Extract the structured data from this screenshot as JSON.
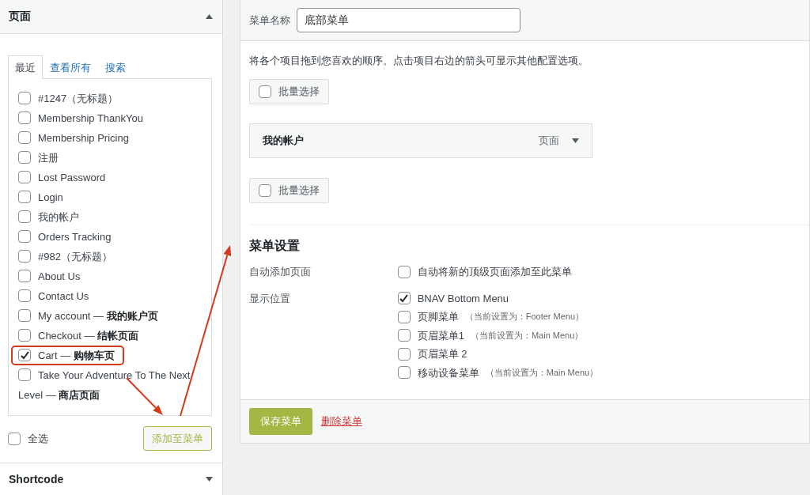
{
  "pages_panel": {
    "title": "页面",
    "expanded": true,
    "tabs": [
      {
        "label": "最近",
        "selected": true
      },
      {
        "label": "查看所有",
        "selected": false
      },
      {
        "label": "搜索",
        "selected": false
      }
    ],
    "items": [
      {
        "label": "#1247（无标题）",
        "checked": false,
        "highlighted": false
      },
      {
        "label": "Membership ThankYou",
        "checked": false,
        "highlighted": false
      },
      {
        "label": "Membership Pricing",
        "checked": false,
        "highlighted": false
      },
      {
        "label": "注册",
        "checked": false,
        "highlighted": false
      },
      {
        "label": "Lost Password",
        "checked": false,
        "highlighted": false
      },
      {
        "label": "Login",
        "checked": false,
        "highlighted": false
      },
      {
        "label": "我的帐户",
        "checked": false,
        "highlighted": false
      },
      {
        "label": "Orders Tracking",
        "checked": false,
        "highlighted": false
      },
      {
        "label": "#982（无标题）",
        "checked": false,
        "highlighted": false
      },
      {
        "label": "About Us",
        "checked": false,
        "highlighted": false
      },
      {
        "label": "Contact Us",
        "checked": false,
        "highlighted": false
      },
      {
        "label": "My account — **我的账户页**",
        "checked": false,
        "highlighted": false
      },
      {
        "label": "Checkout — **结帐页面**",
        "checked": false,
        "highlighted": false
      },
      {
        "label": "Cart — **购物车页**",
        "checked": true,
        "highlighted": true
      },
      {
        "label": "Take Your Adventure To The Next Level — **商店页面**",
        "checked": false,
        "highlighted": false
      }
    ],
    "select_all": {
      "label": "全选",
      "checked": false
    },
    "add_button": "添加至菜单"
  },
  "shortcode_panel": {
    "title": "Shortcode",
    "expanded": false
  },
  "menu_name": {
    "label": "菜单名称",
    "value": "底部菜单"
  },
  "instructions": "将各个项目拖到您喜欢的顺序。点击项目右边的箭头可显示其他配置选项。",
  "bulk_select_top": {
    "label": "批量选择",
    "checked": false
  },
  "menu_items": [
    {
      "title": "我的帐户",
      "type": "页面",
      "expanded": false
    }
  ],
  "bulk_select_bottom": {
    "label": "批量选择",
    "checked": false
  },
  "menu_settings": {
    "title": "菜单设置",
    "rows": [
      {
        "label": "自动添加页面",
        "options": [
          {
            "label": "自动将新的顶级页面添加至此菜单",
            "checked": false
          }
        ]
      },
      {
        "label": "显示位置",
        "options": [
          {
            "label": "BNAV Bottom Menu",
            "checked": true
          },
          {
            "label": "页脚菜单",
            "note": "（当前设置为：Footer Menu）",
            "checked": false
          },
          {
            "label": "页眉菜单1",
            "note": "（当前设置为：Main Menu）",
            "checked": false
          },
          {
            "label": "页眉菜单 2",
            "checked": false
          },
          {
            "label": "移动设备菜单",
            "note": "（当前设置为：Main Menu）",
            "checked": false
          }
        ]
      }
    ]
  },
  "save_button": "保存菜单",
  "delete_link": "删除菜单"
}
